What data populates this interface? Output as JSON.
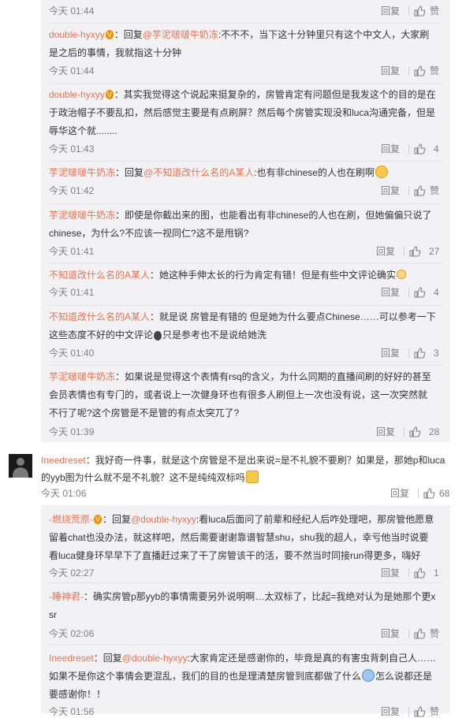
{
  "thread1": {
    "top_meta": {
      "time": "今天 01:44",
      "reply_label": "回复",
      "like_label": "赞"
    },
    "replies": [
      {
        "user": "double-hyxyy",
        "badge": "V",
        "sep": "：回复",
        "mention": "@芋泥啵啵牛奶冻",
        "text": ":不不不，当下这十分钟里只有这个中文人，大家刷是之后的事情，我就指这十分钟",
        "time": "今天 01:44",
        "reply_label": "回复",
        "like_label": "赞"
      },
      {
        "user": "double-hyxyy",
        "badge": "V",
        "text": "：其实我觉得这个说起来挺复杂的，房管肯定有问题但是我发这个的目的是在于政治帽子不要乱扣，然后感觉主要是有点刷屏？然后每个房管实现没和luca沟通完备，但是辱华这个就........",
        "time": "今天 01:43",
        "reply_label": "回复",
        "like_count": "4"
      },
      {
        "user": "芋泥啵啵牛奶冻",
        "sep": "：回复",
        "mention": "@不知道改什么名的A某人",
        "text": ":也有非chinese的人也在刷啊",
        "time": "今天 01:42",
        "reply_label": "回复",
        "like_label": "赞"
      },
      {
        "user": "芋泥啵啵牛奶冻",
        "text": "：即使是你截出来的图，也能看出有非chinese的人也在刷，但她偏偏只说了chinese，为什么?不应该一视同仁?这不是甩锅?",
        "time": "今天 01:41",
        "reply_label": "回复",
        "like_count": "27"
      },
      {
        "user": "不知道改什么名的A某人",
        "text": "：她这种手伸太长的行为肯定有错！但是有些中文评论确实",
        "time": "今天 01:41",
        "reply_label": "回复",
        "like_count": "4"
      },
      {
        "user": "不知道改什么名的A某人",
        "text": "：就是说 房管是有错的 但是她为什么要点Chinese……可以参考一下这些态度不好的中文评论",
        "text2": "只是参考也不是说给她洗",
        "time": "今天 01:40",
        "reply_label": "回复",
        "like_count": "3"
      },
      {
        "user": "芋泥啵啵牛奶冻",
        "text": "：如果说是觉得这个表情有rsq的含义，为什么同期的直播间刷的好好的甚至会员表情也有专门的，或者说上一次健身环也有很多人刷但上一次也没有说，这一次突然就不行了呢?这个房管是不是管的有点太突兀了?",
        "time": "今天 01:39",
        "reply_label": "回复",
        "like_count": "28"
      }
    ]
  },
  "main_comment": {
    "user": "Ineedreset",
    "text": "：我好奇一件事，就是这个房管是不是出来说=是不礼貌不要刷？如果是，那她p和luca的yyb图为什么就不是不礼貌？这不是纯纯双标吗",
    "time": "今天 01:06",
    "reply_label": "回复",
    "like_count": "68"
  },
  "thread2": {
    "replies": [
      {
        "user": "-燃烧荒原-",
        "badge": "V",
        "sep": "：回复",
        "mention": "@double-hyxyy",
        "text": ":看luca后面问了前辈和经纪人后咋处理吧，那房管他愿意留着chat也没办法，就这样吧，然后需要谢谢靠谱智慧shu，shu我的超人，幸亏他当时说要看luca健身环早早下了直播赶过来了干了房管该干的活，要不然当时同接run得更多，嗨好",
        "time": "今天 02:27",
        "reply_label": "回复",
        "like_count": "1"
      },
      {
        "user": "-睡神君-",
        "text": "：确实房管p那yyb的事情需要另外说明啊…太双标了，比起=我绝对认为是她那个更xsr",
        "time": "今天 02:06",
        "reply_label": "回复",
        "like_label": "赞"
      },
      {
        "user": "Ineedreset",
        "sep": "：回复",
        "mention": "@double-hyxyy",
        "text": ":大家肯定还是感谢你的，毕竟是真的有害虫背刺自己人……如果不是你这个事情会更混乱，我们的目的也是理清楚房管到底都做了什么",
        "text2": "怎么说都还是要感谢你！！",
        "time": "今天 01:56",
        "reply_label": "回复",
        "like_label": "赞"
      }
    ]
  }
}
